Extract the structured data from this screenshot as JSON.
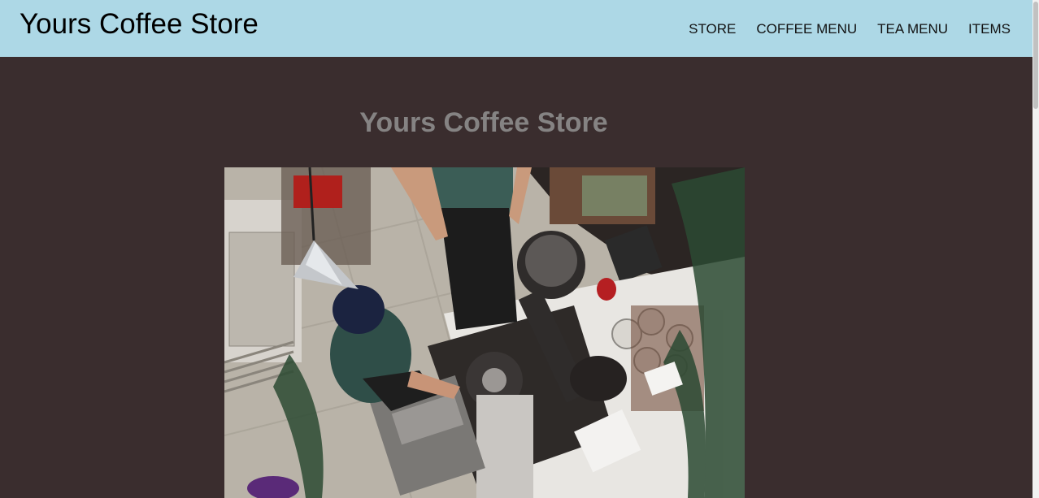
{
  "header": {
    "brand": "Yours Coffee Store",
    "nav": [
      {
        "label": "STORE"
      },
      {
        "label": "COFFEE MENU"
      },
      {
        "label": "TEA MENU"
      },
      {
        "label": "ITEMS"
      }
    ]
  },
  "main": {
    "title": "Yours Coffee Store"
  },
  "colors": {
    "header_bg": "#add8e6",
    "page_bg": "#3a2d2e",
    "title_text": "#858383"
  }
}
